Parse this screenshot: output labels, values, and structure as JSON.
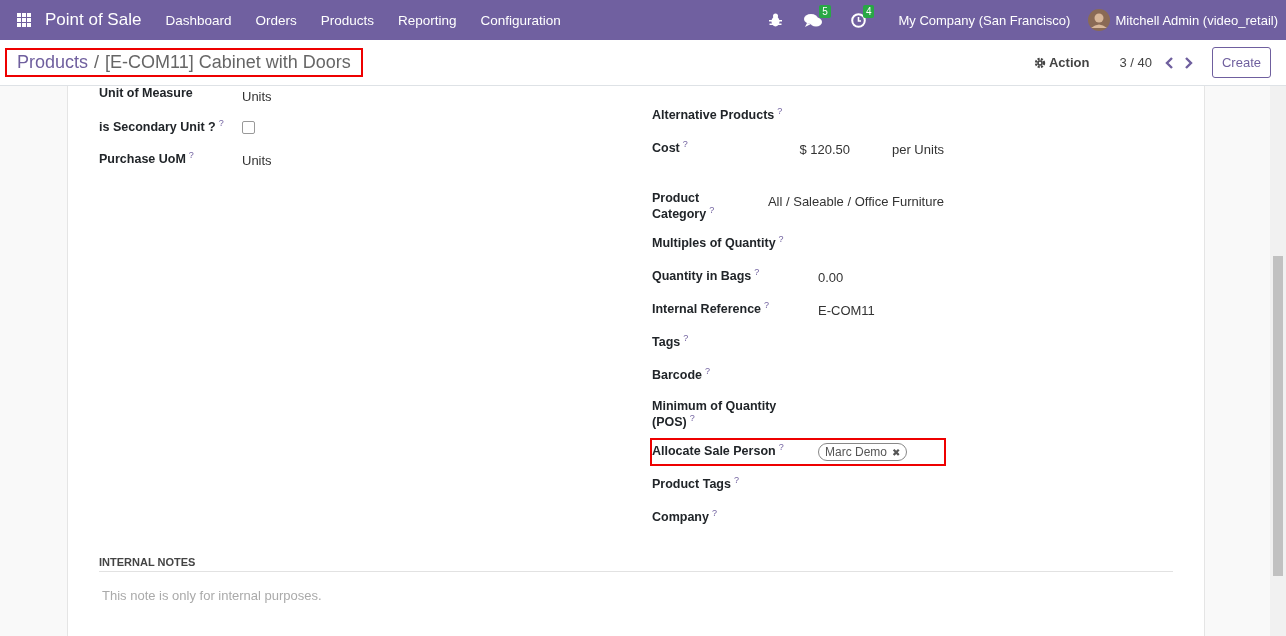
{
  "navbar": {
    "app_name": "Point of Sale",
    "menu": [
      "Dashboard",
      "Orders",
      "Products",
      "Reporting",
      "Configuration"
    ],
    "messages_count": "5",
    "activities_count": "4",
    "company": "My Company (San Francisco)",
    "user": "Mitchell Admin (video_retail)"
  },
  "control_panel": {
    "breadcrumb_parent": "Products",
    "breadcrumb_separator": "/",
    "breadcrumb_current": "[E-COM11] Cabinet with Doors",
    "breadcrumb_highlighted": true,
    "action": "Action",
    "pager": "3 / 40",
    "create": "Create"
  },
  "left_fields": [
    {
      "kind": "text",
      "label": "Unit of Measure",
      "value": "Units"
    },
    {
      "kind": "checkbox",
      "label": "is Secondary Unit ?",
      "help": "?",
      "checked": false
    },
    {
      "kind": "text",
      "label": "Purchase UoM",
      "help": "?",
      "value": "Units"
    }
  ],
  "right_fields": [
    {
      "kind": "text",
      "label": "Alternative Products",
      "help": "?",
      "highlighted": false
    },
    {
      "kind": "cost",
      "label": "Cost",
      "help": "?",
      "value": "$ 120.50",
      "suffix": "per Units",
      "highlighted": false
    },
    {
      "kind": "text",
      "label": "Product Category",
      "help": "?",
      "value": "All / Saleable / Office Furniture",
      "highlighted": false
    },
    {
      "kind": "text",
      "label": "Multiples of Quantity",
      "help": "?",
      "highlighted": false
    },
    {
      "kind": "text",
      "label": "Quantity in Bags",
      "help": "?",
      "value": "0.00",
      "highlighted": false
    },
    {
      "kind": "text",
      "label": "Internal Reference",
      "help": "?",
      "value": "E-COM11",
      "highlighted": false
    },
    {
      "kind": "text",
      "label": "Tags",
      "help": "?",
      "highlighted": false
    },
    {
      "kind": "text",
      "label": "Barcode",
      "help": "?",
      "highlighted": false
    },
    {
      "kind": "text",
      "label": "Minimum of Quantity (POS)",
      "help": "?",
      "highlighted": false
    },
    {
      "kind": "tag",
      "label": "Allocate Sale Person",
      "help": "?",
      "value": "Marc Demo",
      "remove": "✖",
      "highlighted": true
    },
    {
      "kind": "text",
      "label": "Product Tags",
      "help": "?",
      "highlighted": false
    },
    {
      "kind": "text",
      "label": "Company",
      "help": "?",
      "highlighted": false
    }
  ],
  "notes": {
    "heading": "INTERNAL NOTES",
    "placeholder": "This note is only for internal purposes."
  }
}
